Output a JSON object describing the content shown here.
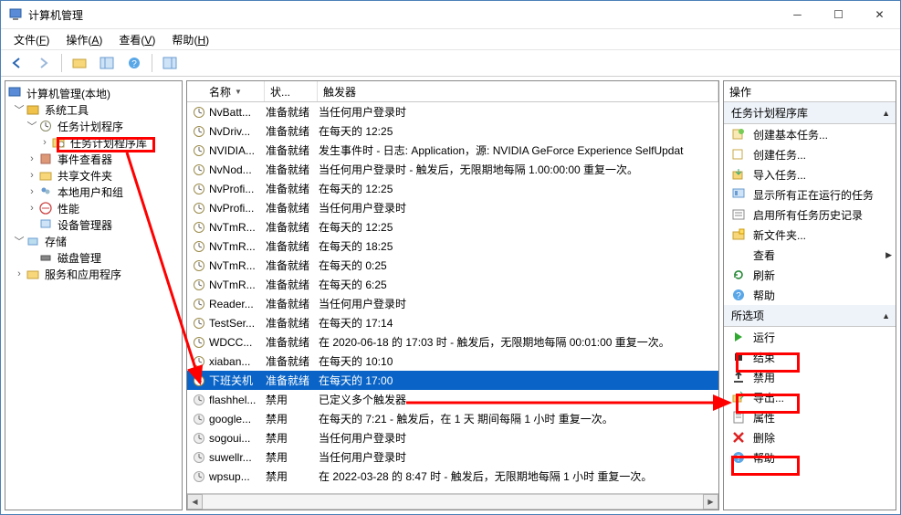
{
  "window": {
    "title": "计算机管理"
  },
  "menubar": [
    {
      "label": "文件",
      "hot": "F"
    },
    {
      "label": "操作",
      "hot": "A"
    },
    {
      "label": "查看",
      "hot": "V"
    },
    {
      "label": "帮助",
      "hot": "H"
    }
  ],
  "tree": {
    "root": "计算机管理(本地)",
    "sys": "系统工具",
    "sched": "任务计划程序",
    "schedlib": "任务计划程序库",
    "evt": "事件查看器",
    "share": "共享文件夹",
    "users": "本地用户和组",
    "perf": "性能",
    "devmgr": "设备管理器",
    "storage": "存储",
    "disk": "磁盘管理",
    "svc": "服务和应用程序"
  },
  "columns": {
    "name": "名称",
    "status": "状...",
    "trigger": "触发器"
  },
  "tasks": [
    {
      "name": "NvBatt...",
      "status": "准备就绪",
      "trigger": "当任何用户登录时"
    },
    {
      "name": "NvDriv...",
      "status": "准备就绪",
      "trigger": "在每天的 12:25"
    },
    {
      "name": "NVIDIA...",
      "status": "准备就绪",
      "trigger": "发生事件时 - 日志: Application，源: NVIDIA GeForce Experience SelfUpdat"
    },
    {
      "name": "NvNod...",
      "status": "准备就绪",
      "trigger": "当任何用户登录时 - 触发后，无限期地每隔 1.00:00:00 重复一次。"
    },
    {
      "name": "NvProfi...",
      "status": "准备就绪",
      "trigger": "在每天的 12:25"
    },
    {
      "name": "NvProfi...",
      "status": "准备就绪",
      "trigger": "当任何用户登录时"
    },
    {
      "name": "NvTmR...",
      "status": "准备就绪",
      "trigger": "在每天的 12:25"
    },
    {
      "name": "NvTmR...",
      "status": "准备就绪",
      "trigger": "在每天的 18:25"
    },
    {
      "name": "NvTmR...",
      "status": "准备就绪",
      "trigger": "在每天的 0:25"
    },
    {
      "name": "NvTmR...",
      "status": "准备就绪",
      "trigger": "在每天的 6:25"
    },
    {
      "name": "Reader...",
      "status": "准备就绪",
      "trigger": "当任何用户登录时"
    },
    {
      "name": "TestSer...",
      "status": "准备就绪",
      "trigger": "在每天的 17:14"
    },
    {
      "name": "WDCC...",
      "status": "准备就绪",
      "trigger": "在 2020-06-18 的 17:03 时 - 触发后，无限期地每隔 00:01:00 重复一次。"
    },
    {
      "name": "xiaban...",
      "status": "准备就绪",
      "trigger": "在每天的 10:10"
    },
    {
      "name": "下班关机",
      "status": "准备就绪",
      "trigger": "在每天的 17:00",
      "selected": true
    },
    {
      "name": "flashhel...",
      "status": "禁用",
      "trigger": "已定义多个触发器"
    },
    {
      "name": "google...",
      "status": "禁用",
      "trigger": "在每天的 7:21 - 触发后，在 1 天 期间每隔 1 小时 重复一次。"
    },
    {
      "name": "sogoui...",
      "status": "禁用",
      "trigger": "当任何用户登录时"
    },
    {
      "name": "suwellr...",
      "status": "禁用",
      "trigger": "当任何用户登录时"
    },
    {
      "name": "wpsup...",
      "status": "禁用",
      "trigger": "在 2022-03-28 的 8:47 时 - 触发后，无限期地每隔 1 小时 重复一次。"
    }
  ],
  "actions": {
    "header": "操作",
    "group1": "任务计划程序库",
    "g1": [
      {
        "icon": "new-basic",
        "label": "创建基本任务..."
      },
      {
        "icon": "new",
        "label": "创建任务..."
      },
      {
        "icon": "import",
        "label": "导入任务..."
      },
      {
        "icon": "show-running",
        "label": "显示所有正在运行的任务"
      },
      {
        "icon": "enable-history",
        "label": "启用所有任务历史记录"
      },
      {
        "icon": "folder",
        "label": "新文件夹..."
      },
      {
        "icon": "view",
        "label": "查看",
        "sub": true
      },
      {
        "icon": "refresh",
        "label": "刷新"
      },
      {
        "icon": "help",
        "label": "帮助"
      }
    ],
    "group2": "所选项",
    "g2": [
      {
        "icon": "run",
        "label": "运行",
        "hl": true
      },
      {
        "icon": "end",
        "label": "结束"
      },
      {
        "icon": "disable",
        "label": "禁用",
        "hl": true
      },
      {
        "icon": "export",
        "label": "导出..."
      },
      {
        "icon": "props",
        "label": "属性"
      },
      {
        "icon": "delete",
        "label": "删除",
        "hl": true
      },
      {
        "icon": "help",
        "label": "帮助"
      }
    ]
  }
}
